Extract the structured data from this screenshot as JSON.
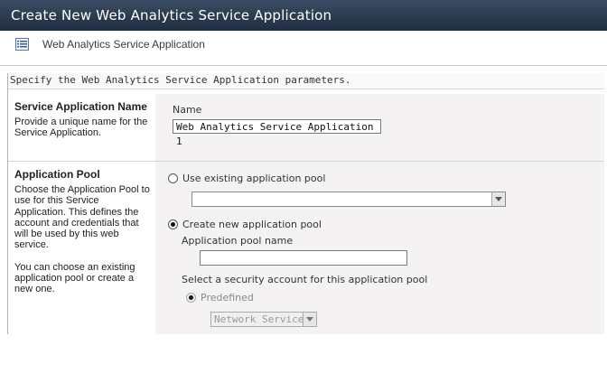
{
  "window": {
    "title": "Create New Web Analytics Service Application"
  },
  "subheader": {
    "label": "Web Analytics Service Application",
    "icon": "list-icon"
  },
  "intro_text": "Specify the Web Analytics Service Application parameters.",
  "service_application_name": {
    "heading": "Service Application Name",
    "description": "Provide a unique name for the Service Application.",
    "field_label": "Name",
    "field_value": "Web Analytics Service Application 1"
  },
  "application_pool": {
    "heading": "Application Pool",
    "description_1": "Choose the Application Pool to use for this Service Application.  This defines the account and credentials that will be used by this web service.",
    "description_2": "You can choose an existing application pool or create a new one.",
    "use_existing_label": "Use existing application pool",
    "use_existing_selected": false,
    "existing_pool_value": "",
    "create_new_label": "Create new application pool",
    "create_new_selected": true,
    "pool_name_label": "Application pool name",
    "pool_name_value": "",
    "security_account_label": "Select a security account for this application pool",
    "predefined_label": "Predefined",
    "predefined_selected": true,
    "predefined_value": "Network Service"
  },
  "colors": {
    "titlebar_top": "#3b4c63",
    "titlebar_bottom": "#1f2d40",
    "panel_bg": "#f5f2f3",
    "section_border": "#9fb6cc"
  }
}
